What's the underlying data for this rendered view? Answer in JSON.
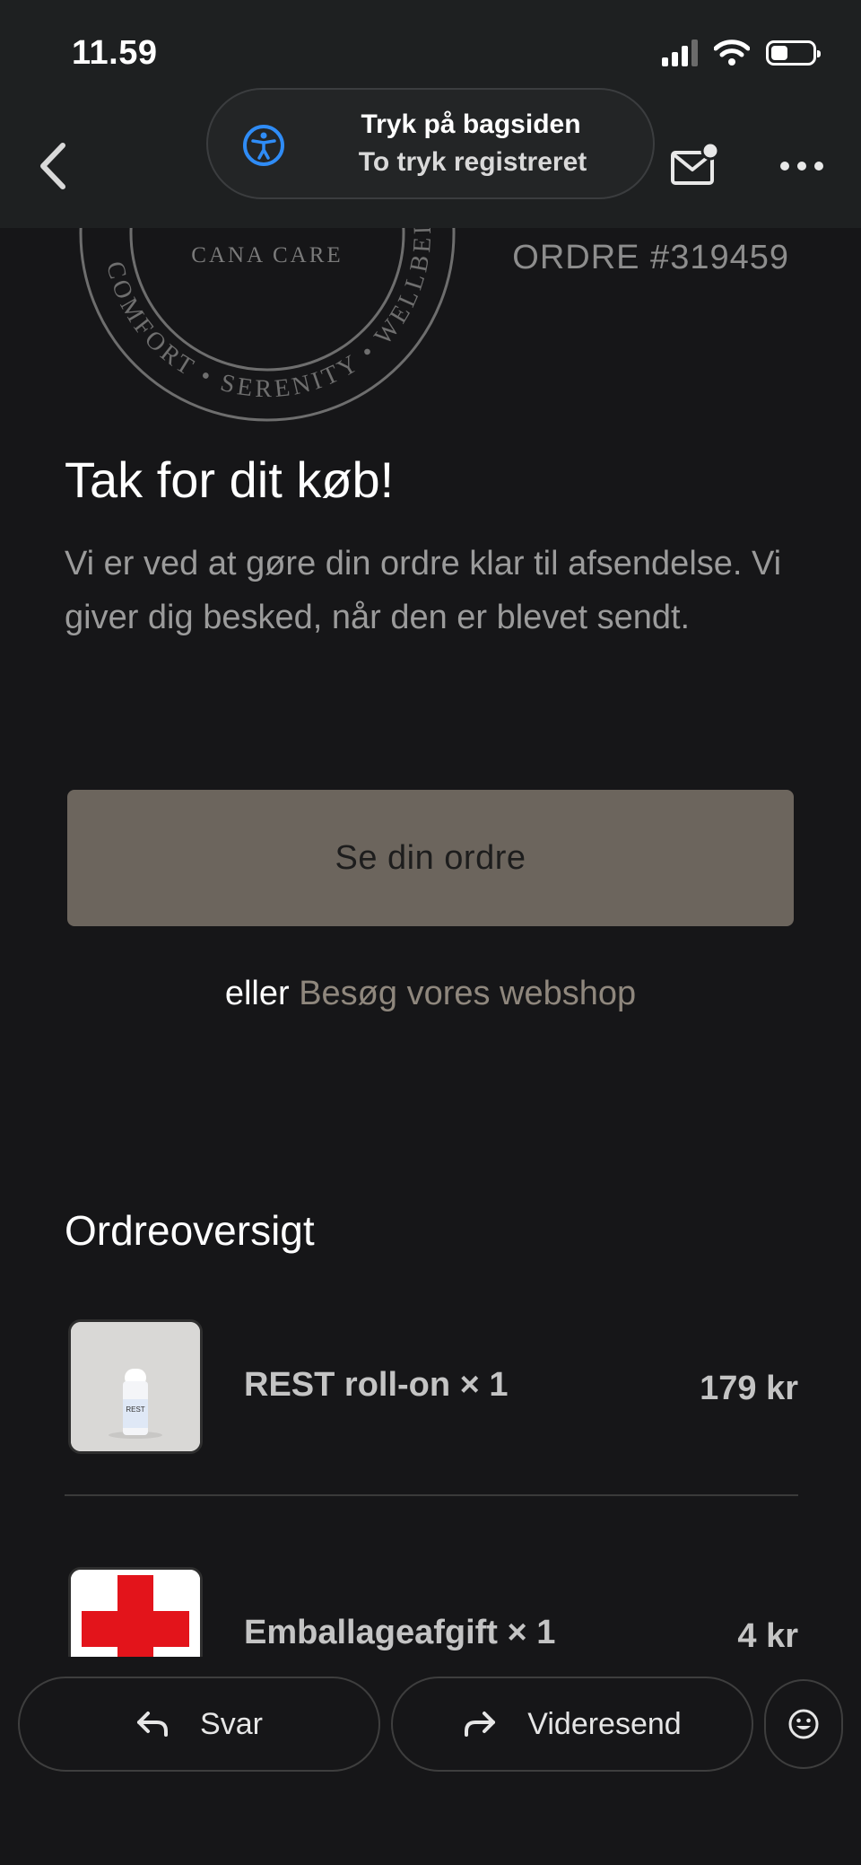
{
  "status_bar": {
    "time": "11.59"
  },
  "toast": {
    "title": "Tryk på bagsiden",
    "subtitle": "To tryk registreret"
  },
  "brand": {
    "name": "CANA CARE",
    "ring_text": "COMFORT • SERENITY • WELLBEING"
  },
  "order": {
    "number_label": "ORDRE #319459"
  },
  "message": {
    "title": "Tak for dit køb!",
    "body": "Vi er ved at gøre din ordre klar til afsendelse. Vi giver dig besked, når den er blevet sendt."
  },
  "cta": {
    "view_order_label": "Se din ordre",
    "or_text": "eller",
    "shop_link_label": "Besøg vores webshop"
  },
  "overview": {
    "title": "Ordreoversigt",
    "items": [
      {
        "name": "REST roll-on × 1",
        "price": "179 kr",
        "thumb_text": "REST"
      },
      {
        "name": "Emballageafgift × 1",
        "price": "4 kr"
      }
    ]
  },
  "actions": {
    "reply_label": "Svar",
    "forward_label": "Videresend"
  },
  "colors": {
    "background": "#161618",
    "button_fill": "#6c655d",
    "link": "#8f877d",
    "accessibility_blue": "#2f8cf6",
    "red_cross": "#e3141b"
  },
  "icons": [
    "back-chevron-icon",
    "accessibility-icon",
    "mail-unread-icon",
    "more-icon",
    "reply-icon",
    "forward-icon",
    "emoji-icon",
    "trash-icon"
  ]
}
